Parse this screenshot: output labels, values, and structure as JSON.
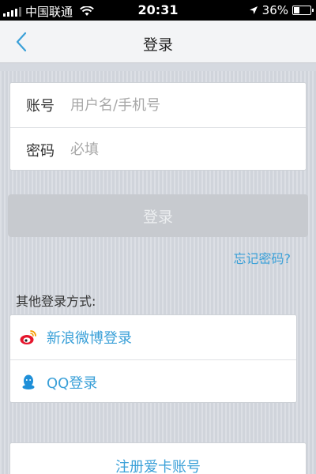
{
  "status_bar": {
    "carrier": "中国联通",
    "time": "20:31",
    "battery": "36%",
    "battery_level": 0.36
  },
  "nav": {
    "title": "登录",
    "back_icon": "chevron-left-icon"
  },
  "form": {
    "account_label": "账号",
    "account_placeholder": "用户名/手机号",
    "password_label": "密码",
    "password_placeholder": "必填"
  },
  "login_button": "登录",
  "forgot_password": "忘记密码?",
  "other_methods": {
    "label": "其他登录方式:",
    "items": [
      {
        "label": "新浪微博登录",
        "icon": "weibo-icon"
      },
      {
        "label": "QQ登录",
        "icon": "qq-icon"
      }
    ]
  },
  "register": "注册爱卡账号",
  "colors": {
    "accent": "#3aa0d8",
    "background": "#d4d8df",
    "button_disabled": "#c7cacf"
  }
}
